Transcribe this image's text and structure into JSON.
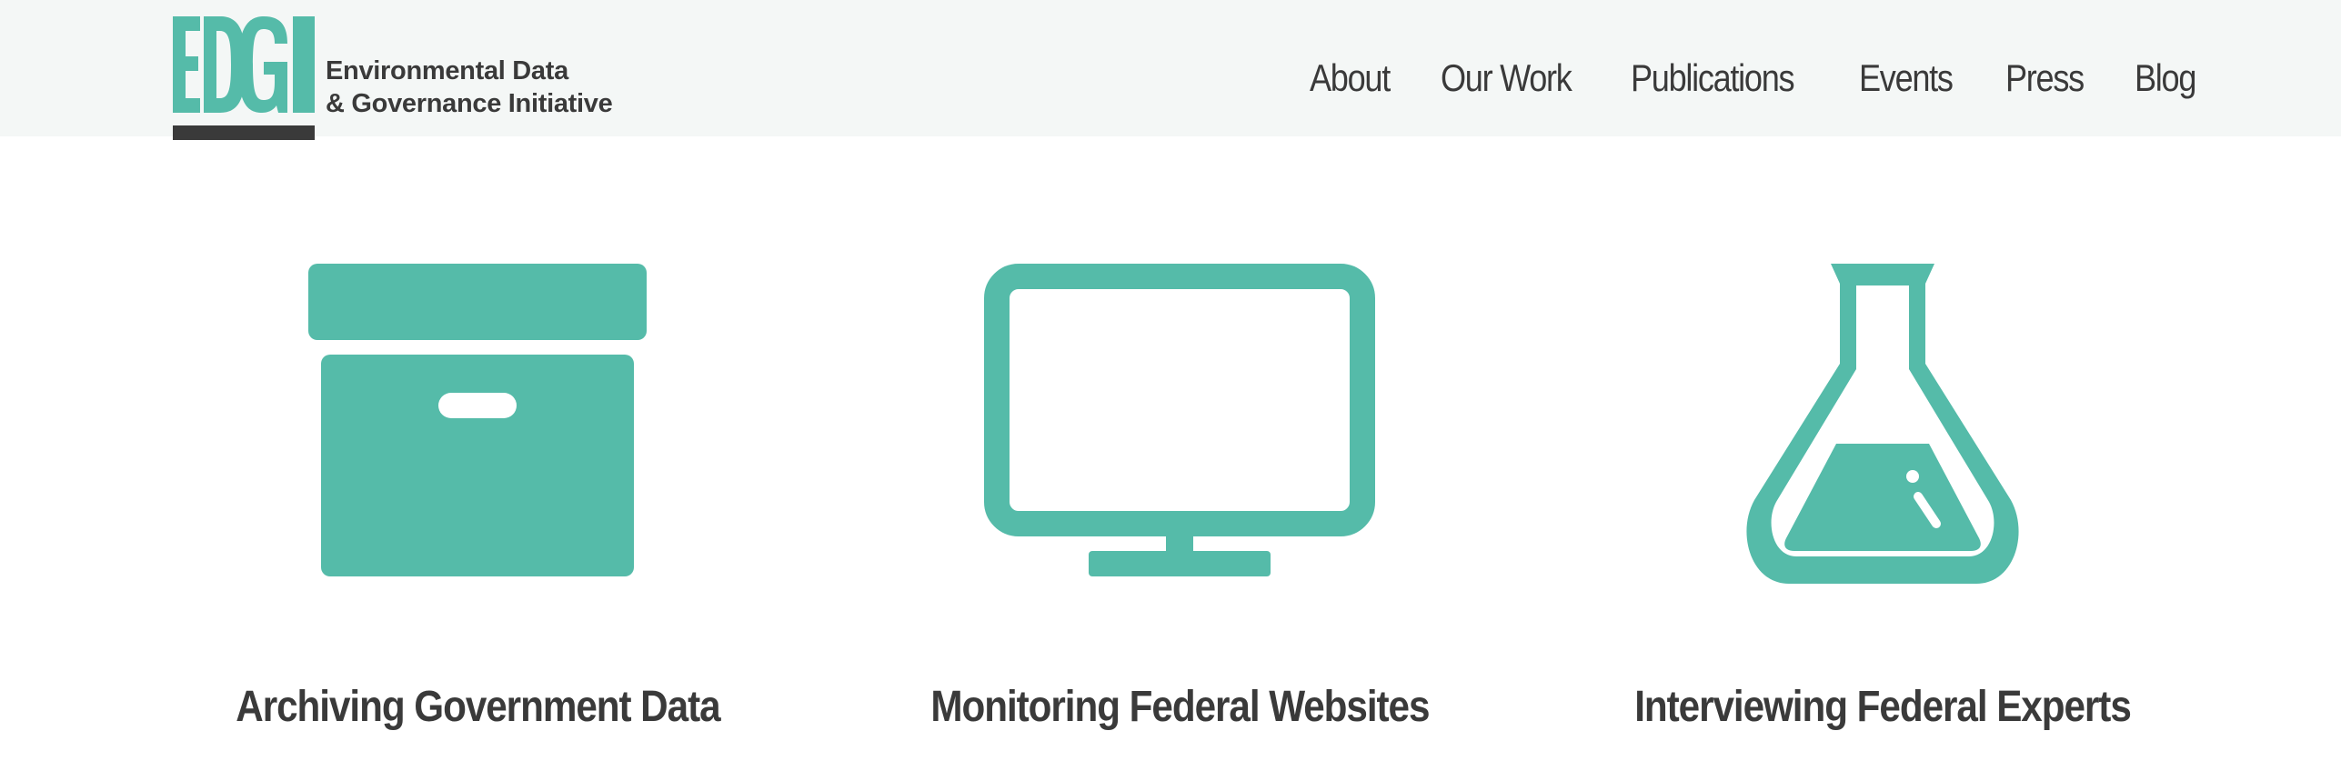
{
  "colors": {
    "accent": "#55bba9",
    "text": "#3a3a3a",
    "header_bg": "#f4f7f6"
  },
  "logo": {
    "mark_text": "EDGI",
    "line1": "Environmental Data",
    "line2": "& Governance Initiative"
  },
  "nav": {
    "items": [
      {
        "label": "About"
      },
      {
        "label": "Our Work"
      },
      {
        "label": "Publications"
      },
      {
        "label": "Events"
      },
      {
        "label": "Press"
      },
      {
        "label": "Blog"
      }
    ]
  },
  "features": [
    {
      "icon": "archive-box-icon",
      "title": "Archiving Government Data"
    },
    {
      "icon": "monitor-icon",
      "title": "Monitoring Federal Websites"
    },
    {
      "icon": "flask-icon",
      "title": "Interviewing Federal Experts"
    }
  ]
}
